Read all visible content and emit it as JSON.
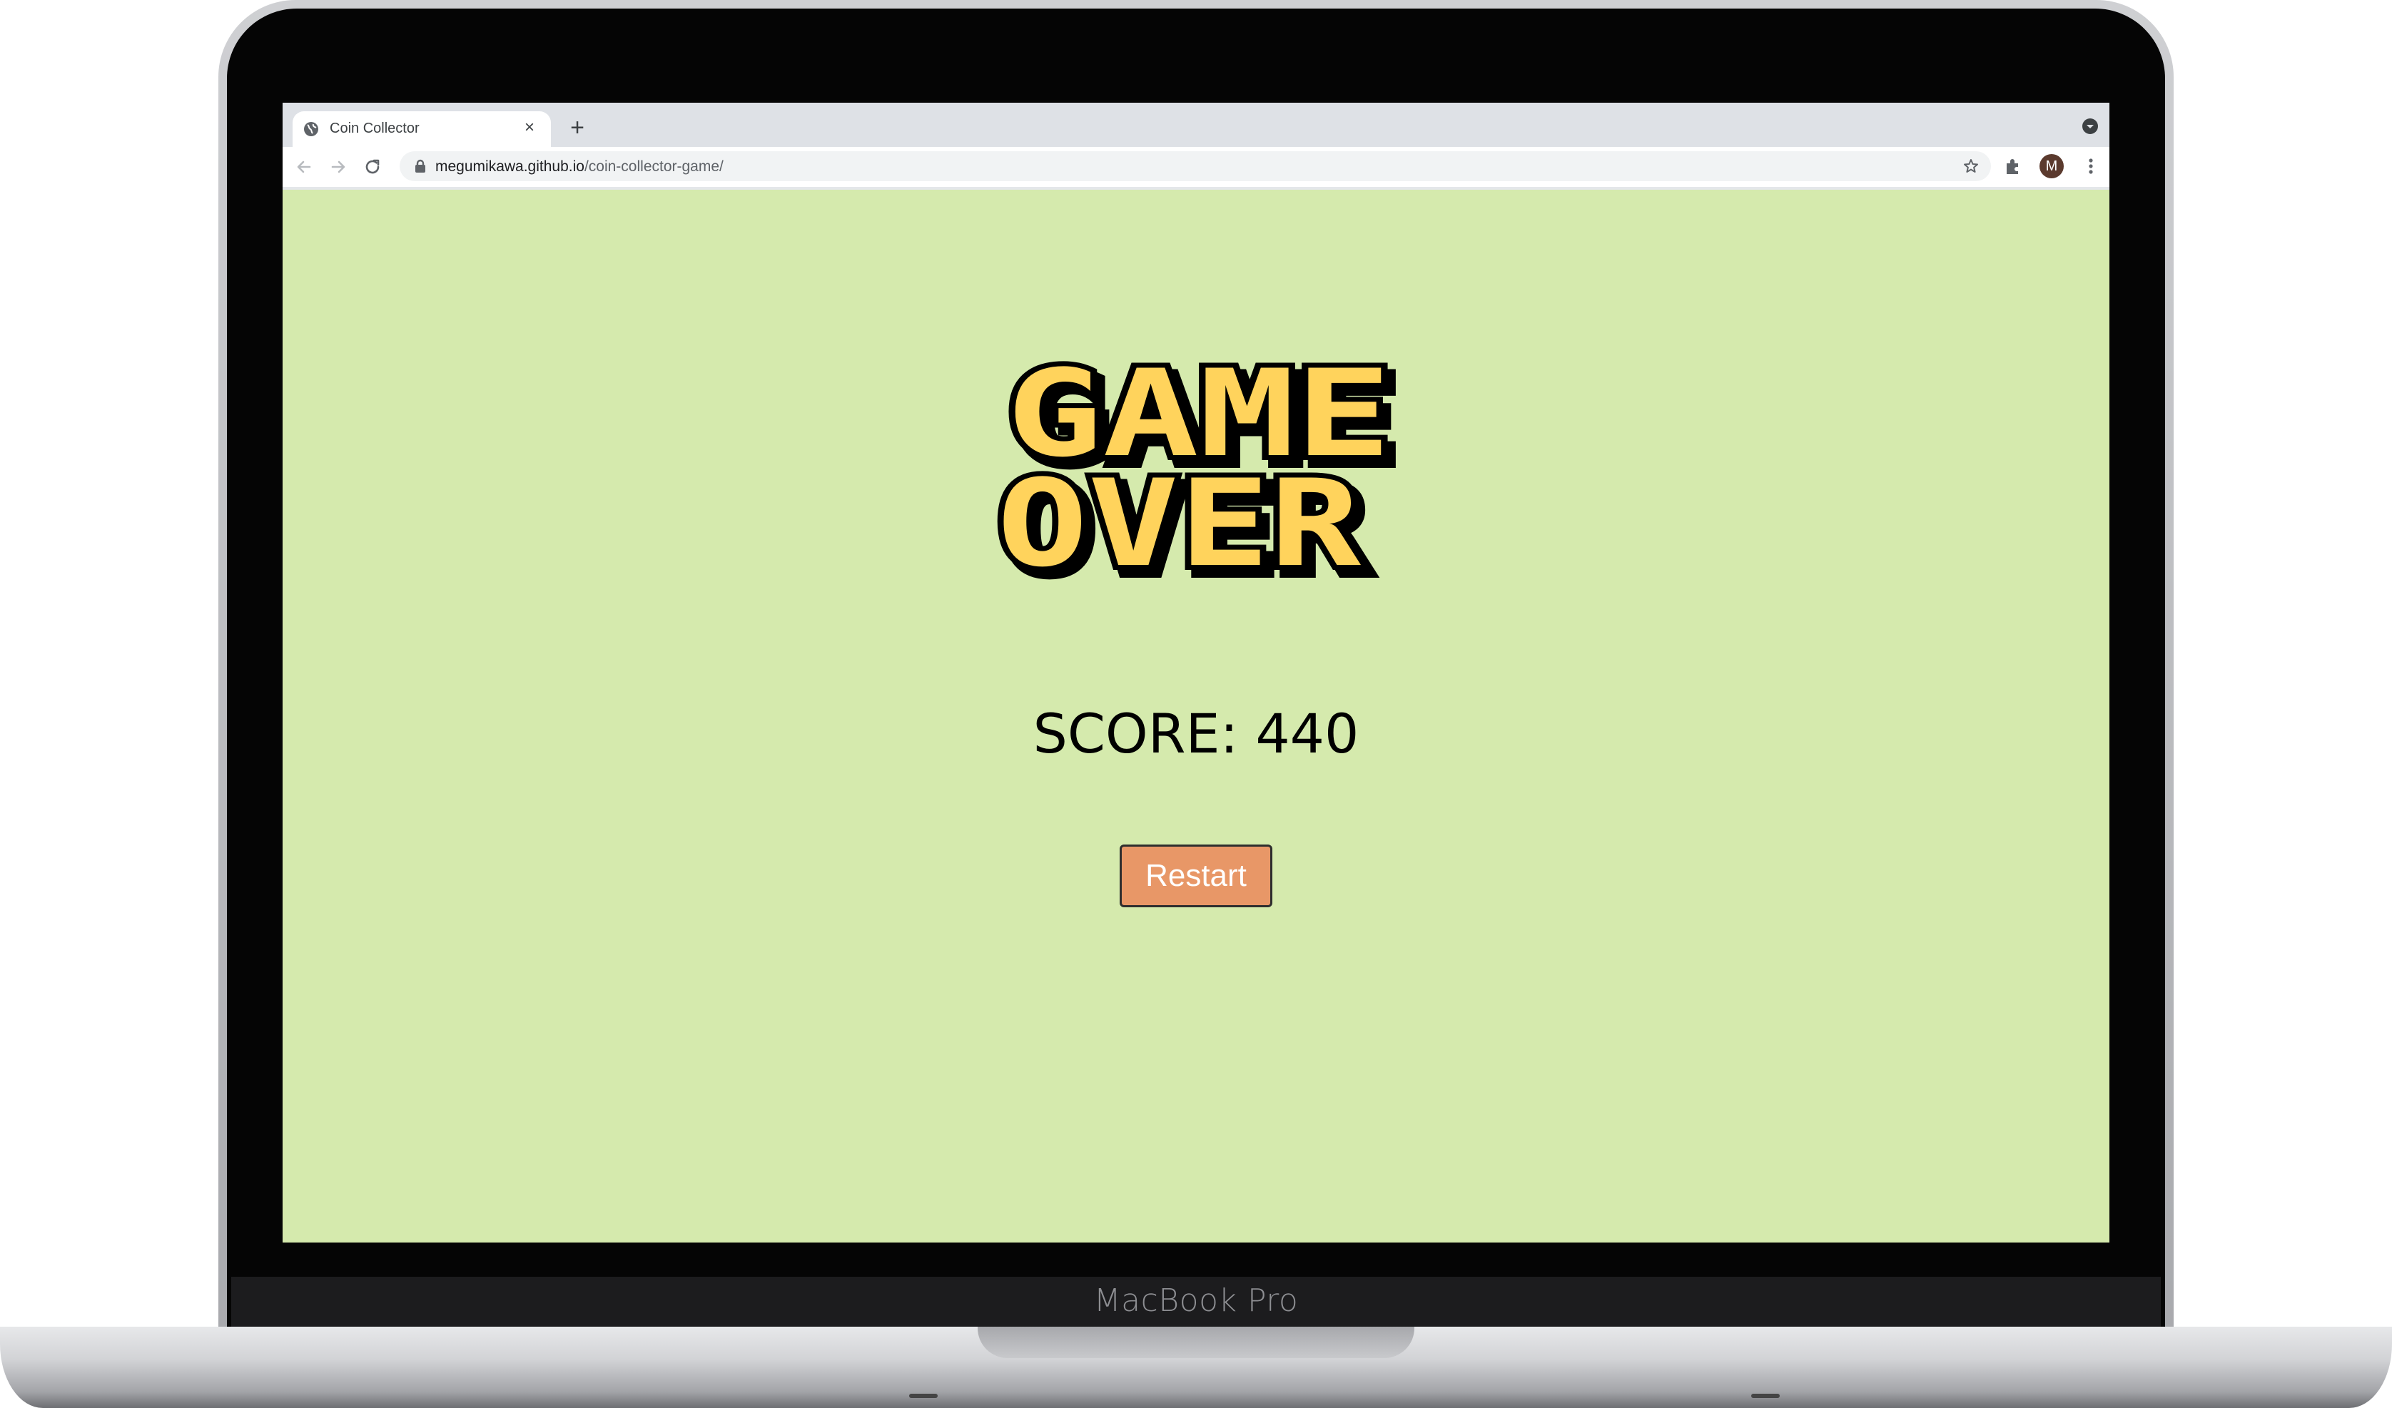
{
  "device": {
    "brand_label": "MacBook Pro"
  },
  "browser": {
    "tab": {
      "title": "Coin Collector",
      "close_glyph": "×",
      "favicon": "globe-icon"
    },
    "new_tab_glyph": "+",
    "address": {
      "host": "megumikawa.github.io",
      "path": "/coin-collector-game/"
    },
    "profile_initial": "M",
    "icons": [
      "back-icon",
      "forward-icon",
      "reload-icon",
      "lock-icon",
      "star-icon",
      "extensions-icon",
      "menu-icon",
      "tab-search-icon"
    ]
  },
  "game": {
    "title_line1": "GAME",
    "title_line2": "OVER",
    "title_fill_color": "#ffd35c",
    "background_color": "#d5eaad",
    "score_text": "SCORE: 440",
    "restart_label": "Restart",
    "restart_color": "#e89767"
  }
}
